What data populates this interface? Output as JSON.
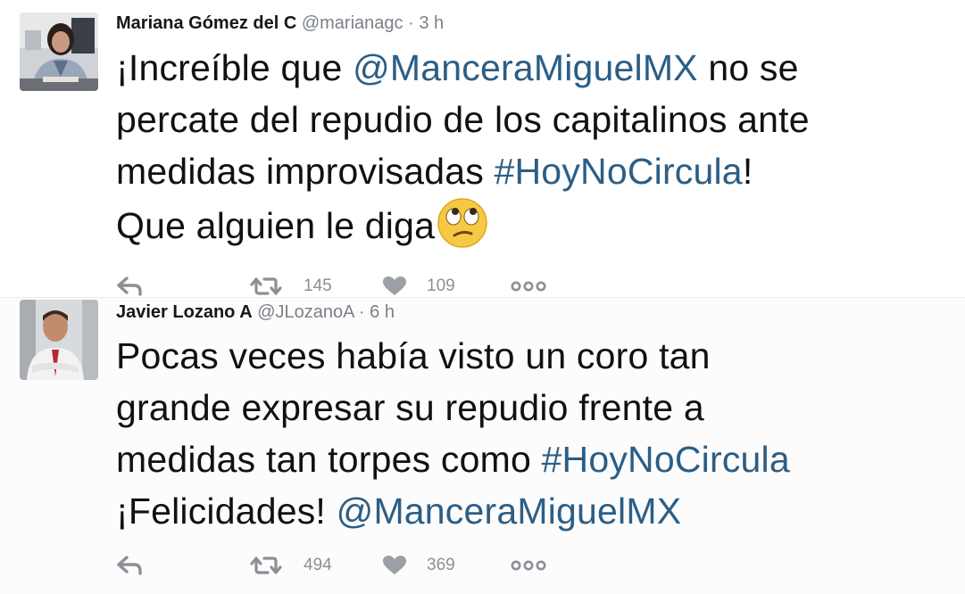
{
  "tweets": [
    {
      "name": "Mariana Gómez del C",
      "handle": "@marianagc",
      "separator": "·",
      "time": "3 h",
      "avatar_icon": "woman-portrait-avatar",
      "body_lines": [
        {
          "pre": "¡Increíble que ",
          "link": "@ManceraMiguelMX",
          "post": " no se"
        },
        {
          "pre": "percate del repudio de los capitalinos ante",
          "link": "",
          "post": ""
        },
        {
          "pre": "medidas improvisadas ",
          "link": "#HoyNoCircula",
          "post": "!"
        },
        {
          "pre": "Que alguien le diga",
          "link": "",
          "post": ""
        }
      ],
      "emoji": "face-with-rolling-eyes-emoji",
      "retweets": "145",
      "likes": "109"
    },
    {
      "name": "Javier Lozano A",
      "handle": "@JLozanoA",
      "separator": "·",
      "time": "6 h",
      "avatar_icon": "man-portrait-avatar",
      "body_lines": [
        {
          "pre": "Pocas veces había visto un coro tan",
          "link": "",
          "post": ""
        },
        {
          "pre": "grande expresar su repudio frente a",
          "link": "",
          "post": ""
        },
        {
          "pre": "medidas tan torpes como ",
          "link": "#HoyNoCircula",
          "post": ""
        },
        {
          "pre": "¡Felicidades! ",
          "link": "@ManceraMiguelMX",
          "post": ""
        }
      ],
      "retweets": "494",
      "likes": "369"
    }
  ],
  "colors": {
    "link": "#2b5e86",
    "text": "#111111",
    "meta": "#7a8087",
    "icon": "#8a9096"
  },
  "icons": {
    "reply": "reply-arrow-icon",
    "retweet": "retweet-icon",
    "like": "heart-icon",
    "more": "more-dots-icon"
  }
}
